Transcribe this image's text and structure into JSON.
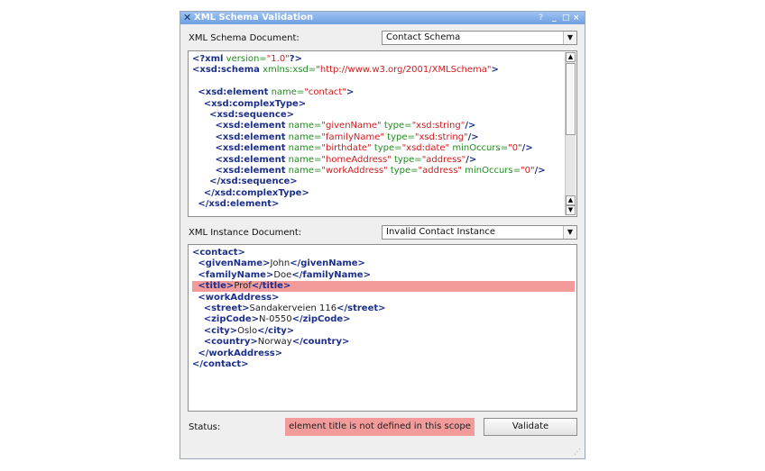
{
  "window": {
    "title": "XML Schema Validation",
    "controls": {
      "help": "?",
      "minimize": "_",
      "maximize": "□",
      "close": "×"
    }
  },
  "schema": {
    "label": "XML Schema Document:",
    "selected": "Contact Schema",
    "lines": [
      [
        {
          "c": "t",
          "s": "<?xml"
        },
        {
          "c": "a",
          "s": " version="
        },
        {
          "c": "v",
          "s": "\"1.0\""
        },
        {
          "c": "t",
          "s": "?>"
        }
      ],
      [
        {
          "c": "t",
          "s": "<xsd:schema"
        },
        {
          "c": "a",
          "s": " xmlns:xsd="
        },
        {
          "c": "v",
          "s": "\"http://www.w3.org/2001/XMLSchema\""
        },
        {
          "c": "t",
          "s": ">"
        }
      ],
      [],
      [
        {
          "c": "x",
          "s": "  "
        },
        {
          "c": "t",
          "s": "<xsd:element"
        },
        {
          "c": "a",
          "s": " name="
        },
        {
          "c": "v",
          "s": "\"contact\""
        },
        {
          "c": "t",
          "s": ">"
        }
      ],
      [
        {
          "c": "x",
          "s": "    "
        },
        {
          "c": "t",
          "s": "<xsd:complexType>"
        }
      ],
      [
        {
          "c": "x",
          "s": "      "
        },
        {
          "c": "t",
          "s": "<xsd:sequence>"
        }
      ],
      [
        {
          "c": "x",
          "s": "        "
        },
        {
          "c": "t",
          "s": "<xsd:element"
        },
        {
          "c": "a",
          "s": " name="
        },
        {
          "c": "v",
          "s": "\"givenName\""
        },
        {
          "c": "a",
          "s": " type="
        },
        {
          "c": "v",
          "s": "\"xsd:string\""
        },
        {
          "c": "t",
          "s": "/>"
        }
      ],
      [
        {
          "c": "x",
          "s": "        "
        },
        {
          "c": "t",
          "s": "<xsd:element"
        },
        {
          "c": "a",
          "s": " name="
        },
        {
          "c": "v",
          "s": "\"familyName\""
        },
        {
          "c": "a",
          "s": " type="
        },
        {
          "c": "v",
          "s": "\"xsd:string\""
        },
        {
          "c": "t",
          "s": "/>"
        }
      ],
      [
        {
          "c": "x",
          "s": "        "
        },
        {
          "c": "t",
          "s": "<xsd:element"
        },
        {
          "c": "a",
          "s": " name="
        },
        {
          "c": "v",
          "s": "\"birthdate\""
        },
        {
          "c": "a",
          "s": " type="
        },
        {
          "c": "v",
          "s": "\"xsd:date\""
        },
        {
          "c": "a",
          "s": " minOccurs="
        },
        {
          "c": "v",
          "s": "\"0\""
        },
        {
          "c": "t",
          "s": "/>"
        }
      ],
      [
        {
          "c": "x",
          "s": "        "
        },
        {
          "c": "t",
          "s": "<xsd:element"
        },
        {
          "c": "a",
          "s": " name="
        },
        {
          "c": "v",
          "s": "\"homeAddress\""
        },
        {
          "c": "a",
          "s": " type="
        },
        {
          "c": "v",
          "s": "\"address\""
        },
        {
          "c": "t",
          "s": "/>"
        }
      ],
      [
        {
          "c": "x",
          "s": "        "
        },
        {
          "c": "t",
          "s": "<xsd:element"
        },
        {
          "c": "a",
          "s": " name="
        },
        {
          "c": "v",
          "s": "\"workAddress\""
        },
        {
          "c": "a",
          "s": " type="
        },
        {
          "c": "v",
          "s": "\"address\""
        },
        {
          "c": "a",
          "s": " minOccurs="
        },
        {
          "c": "v",
          "s": "\"0\""
        },
        {
          "c": "t",
          "s": "/>"
        }
      ],
      [
        {
          "c": "x",
          "s": "      "
        },
        {
          "c": "t",
          "s": "</xsd:sequence>"
        }
      ],
      [
        {
          "c": "x",
          "s": "    "
        },
        {
          "c": "t",
          "s": "</xsd:complexType>"
        }
      ],
      [
        {
          "c": "x",
          "s": "  "
        },
        {
          "c": "t",
          "s": "</xsd:element>"
        }
      ]
    ]
  },
  "instance": {
    "label": "XML Instance Document:",
    "selected": "Invalid Contact Instance",
    "error_line": 3,
    "lines": [
      [
        {
          "c": "t",
          "s": "<contact>"
        }
      ],
      [
        {
          "c": "x",
          "s": "  "
        },
        {
          "c": "t",
          "s": "<givenName>"
        },
        {
          "c": "x",
          "s": "John"
        },
        {
          "c": "t",
          "s": "</givenName>"
        }
      ],
      [
        {
          "c": "x",
          "s": "  "
        },
        {
          "c": "t",
          "s": "<familyName>"
        },
        {
          "c": "x",
          "s": "Doe"
        },
        {
          "c": "t",
          "s": "</familyName>"
        }
      ],
      [
        {
          "c": "x",
          "s": "  "
        },
        {
          "c": "t",
          "s": "<title>"
        },
        {
          "c": "x",
          "s": "Prof"
        },
        {
          "c": "t",
          "s": "</title>"
        }
      ],
      [
        {
          "c": "x",
          "s": "  "
        },
        {
          "c": "t",
          "s": "<workAddress>"
        }
      ],
      [
        {
          "c": "x",
          "s": "    "
        },
        {
          "c": "t",
          "s": "<street>"
        },
        {
          "c": "x",
          "s": "Sandakerveien 116"
        },
        {
          "c": "t",
          "s": "</street>"
        }
      ],
      [
        {
          "c": "x",
          "s": "    "
        },
        {
          "c": "t",
          "s": "<zipCode>"
        },
        {
          "c": "x",
          "s": "N-0550"
        },
        {
          "c": "t",
          "s": "</zipCode>"
        }
      ],
      [
        {
          "c": "x",
          "s": "    "
        },
        {
          "c": "t",
          "s": "<city>"
        },
        {
          "c": "x",
          "s": "Oslo"
        },
        {
          "c": "t",
          "s": "</city>"
        }
      ],
      [
        {
          "c": "x",
          "s": "    "
        },
        {
          "c": "t",
          "s": "<country>"
        },
        {
          "c": "x",
          "s": "Norway"
        },
        {
          "c": "t",
          "s": "</country>"
        }
      ],
      [
        {
          "c": "x",
          "s": "  "
        },
        {
          "c": "t",
          "s": "</workAddress>"
        }
      ],
      [
        {
          "c": "t",
          "s": "</contact>"
        }
      ]
    ]
  },
  "status": {
    "label": "Status:",
    "message": "element title is not defined in this scope",
    "error_color": "#f39a9a"
  },
  "validate_label": "Validate"
}
